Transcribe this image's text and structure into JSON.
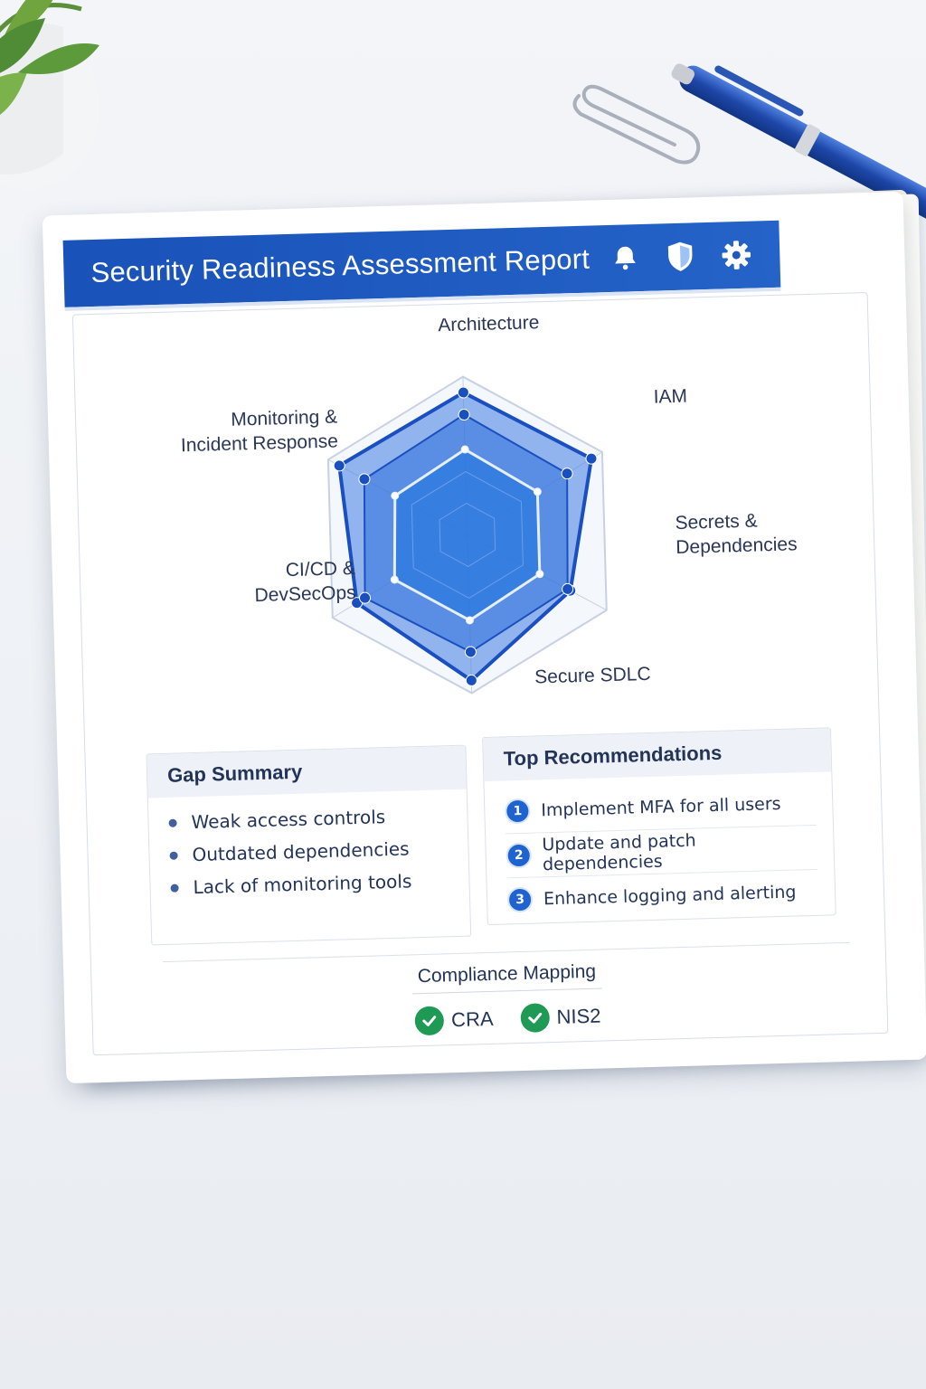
{
  "report": {
    "title": "Security Readiness Assessment Report",
    "header_icons": [
      "bell-icon",
      "shield-icon",
      "gear-icon"
    ]
  },
  "chart_data": {
    "type": "radar",
    "axes": [
      "Architecture",
      "IAM",
      "Secrets & Dependencies",
      "Secure SDLC",
      "CI/CD & DevSecOps",
      "Monitoring & Incident Response"
    ],
    "axis_label_lines": [
      [
        "Architecture"
      ],
      [
        "IAM"
      ],
      [
        "Secrets &",
        "Dependencies"
      ],
      [
        "Secure SDLC"
      ],
      [
        "CI/CD &",
        "DevSecOps"
      ],
      [
        "Monitoring &",
        "Incident Response"
      ]
    ],
    "rlim": [
      0,
      5
    ],
    "rings": 5,
    "series": [
      {
        "values": [
          4.5,
          4.6,
          3.7,
          4.6,
          4.1,
          4.6
        ]
      },
      {
        "values": [
          3.8,
          3.7,
          3.6,
          3.7,
          3.8,
          3.7
        ]
      },
      {
        "values": [
          2.7,
          2.6,
          2.6,
          2.7,
          2.7,
          2.6
        ]
      }
    ],
    "colors": {
      "outer_fill": "#3f7de3",
      "outer_stroke": "#1a4fc0",
      "mid_fill": "#2d6fdb",
      "inner_fill": "#2c78e0",
      "inner_stroke": "#e6efff",
      "grid": "#c7d1e3"
    }
  },
  "gap_summary": {
    "title": "Gap Summary",
    "items": [
      "Weak access controls",
      "Outdated dependencies",
      "Lack of monitoring tools"
    ]
  },
  "recommendations": {
    "title": "Top Recommendations",
    "items": [
      {
        "num": "1",
        "text": "Implement MFA for all users"
      },
      {
        "num": "2",
        "text": "Update and patch dependencies"
      },
      {
        "num": "3",
        "text": "Enhance logging and alerting"
      }
    ]
  },
  "compliance": {
    "title": "Compliance Mapping",
    "items": [
      "CRA",
      "NIS2"
    ],
    "check_color": "#1e9a55"
  }
}
